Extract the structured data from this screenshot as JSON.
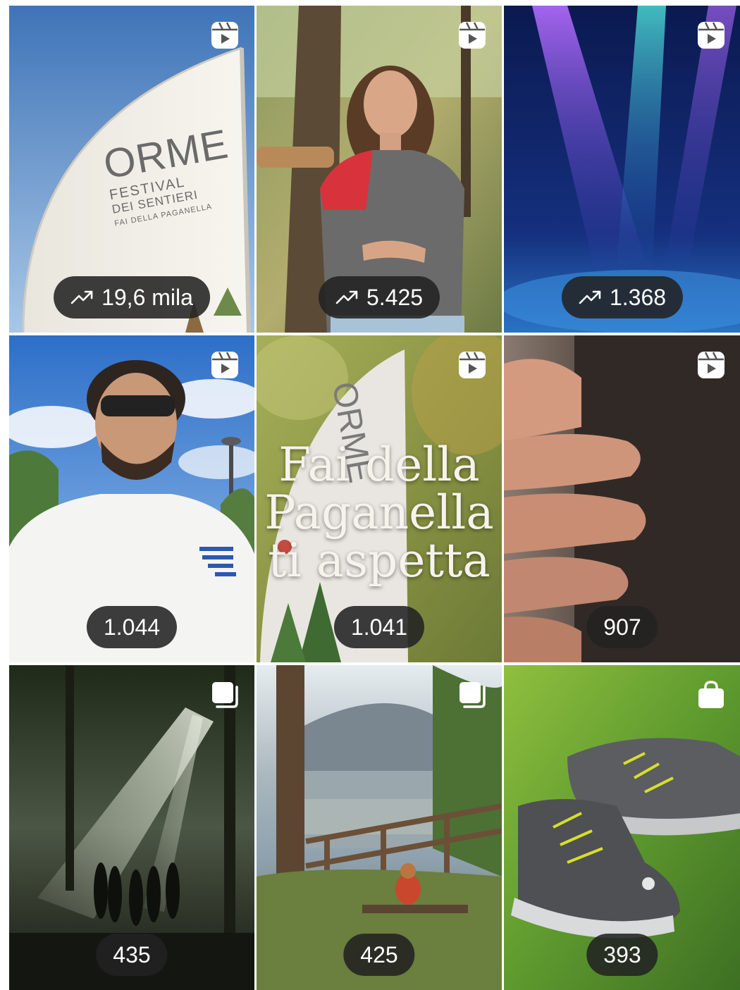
{
  "grid": {
    "tiles": [
      {
        "type": "reel-icon",
        "views": "19,6 mila",
        "trending": true,
        "flag_text": [
          "ORME",
          "FESTIVAL",
          "DEI SENTIERI",
          "FAI DELLA PAGANELLA"
        ]
      },
      {
        "type": "reel-icon",
        "views": "5.425",
        "trending": true
      },
      {
        "type": "reel-icon",
        "views": "1.368",
        "trending": true
      },
      {
        "type": "reel-icon",
        "views": "1.044",
        "trending": false
      },
      {
        "type": "reel-icon",
        "views": "1.041",
        "trending": false,
        "flag_text": "ORME",
        "overlay": "Fai della Paganella ti aspetta"
      },
      {
        "type": "reel-icon",
        "views": "907",
        "trending": false
      },
      {
        "type": "carousel-icon",
        "views": "435",
        "trending": false
      },
      {
        "type": "carousel-icon",
        "views": "425",
        "trending": false
      },
      {
        "type": "shopping-bag-icon",
        "views": "393",
        "trending": false
      }
    ]
  }
}
